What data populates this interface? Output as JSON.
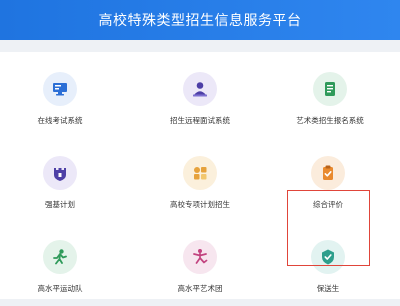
{
  "header": {
    "title": "高校特殊类型招生信息服务平台"
  },
  "tiles": [
    {
      "label": "在线考试系统",
      "icon": "computer-exam-icon",
      "bg": "#e7effb",
      "color": "#2c6fd6"
    },
    {
      "label": "招生远程面试系统",
      "icon": "remote-interview-icon",
      "bg": "#ece8f8",
      "color": "#4d3fa6"
    },
    {
      "label": "艺术类招生报名系统",
      "icon": "art-registration-icon",
      "bg": "#e4f3ea",
      "color": "#2f9a5a"
    },
    {
      "label": "强基计划",
      "icon": "castle-icon",
      "bg": "#ece8f8",
      "color": "#4d3fa6"
    },
    {
      "label": "高校专项计划招生",
      "icon": "grid-plan-icon",
      "bg": "#fbf0dc",
      "color": "#e6a23c"
    },
    {
      "label": "综合评价",
      "icon": "clipboard-check-icon",
      "bg": "#fbecdc",
      "color": "#e98a2e"
    },
    {
      "label": "高水平运动队",
      "icon": "athlete-icon",
      "bg": "#e4f3ea",
      "color": "#2f9a5a"
    },
    {
      "label": "高水平艺术团",
      "icon": "dancer-icon",
      "bg": "#f7e6ef",
      "color": "#c2437f"
    },
    {
      "label": "保送生",
      "icon": "badge-check-icon",
      "bg": "#e2f3f1",
      "color": "#2d9e8c"
    }
  ]
}
